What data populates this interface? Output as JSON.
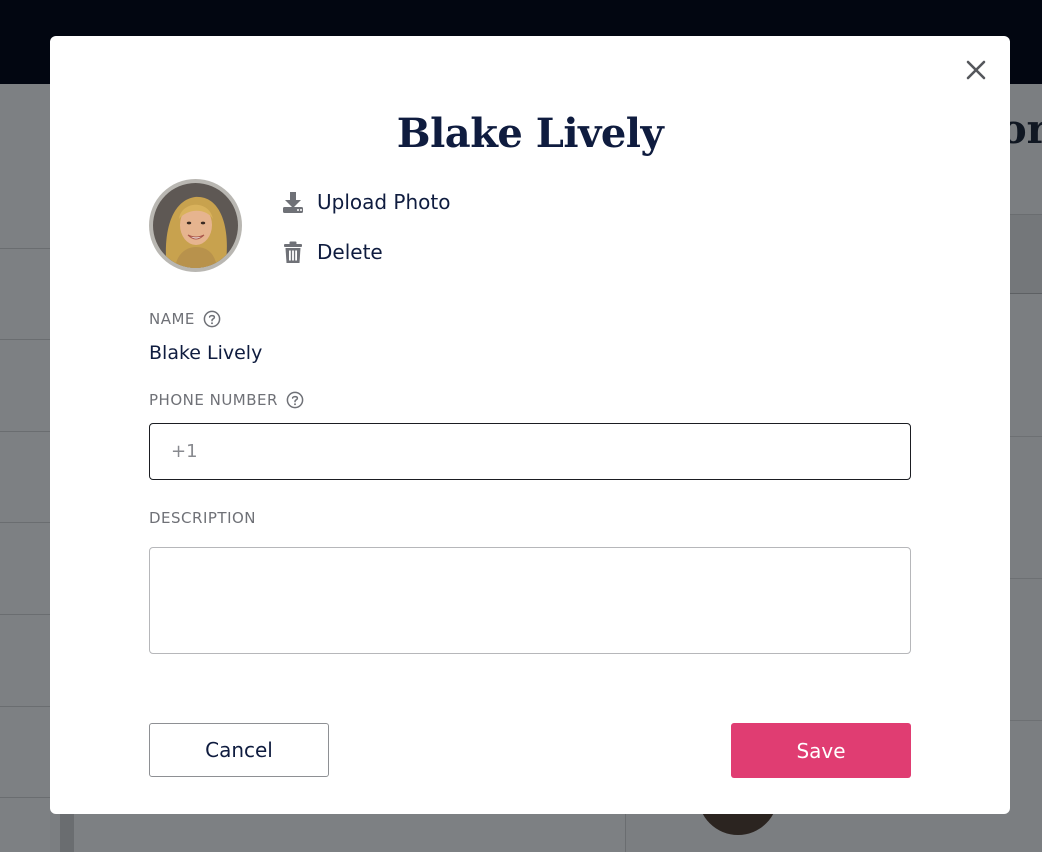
{
  "background": {
    "partial_title": "or"
  },
  "modal": {
    "title": "Blake Lively",
    "close_icon": "close-icon",
    "photo": {
      "upload_label": "Upload Photo",
      "upload_icon": "download-tray-icon",
      "delete_label": "Delete",
      "delete_icon": "trash-icon"
    },
    "fields": {
      "name": {
        "label": "NAME",
        "value": "Blake Lively",
        "help_icon": "question-circle-icon"
      },
      "phone": {
        "label": "PHONE NUMBER",
        "placeholder": "+1",
        "value": "",
        "help_icon": "question-circle-icon"
      },
      "description": {
        "label": "DESCRIPTION",
        "value": ""
      }
    },
    "buttons": {
      "cancel_label": "Cancel",
      "save_label": "Save"
    }
  },
  "colors": {
    "accent": "#e03d72",
    "title": "#0f1c3f",
    "topbar": "#020611"
  }
}
